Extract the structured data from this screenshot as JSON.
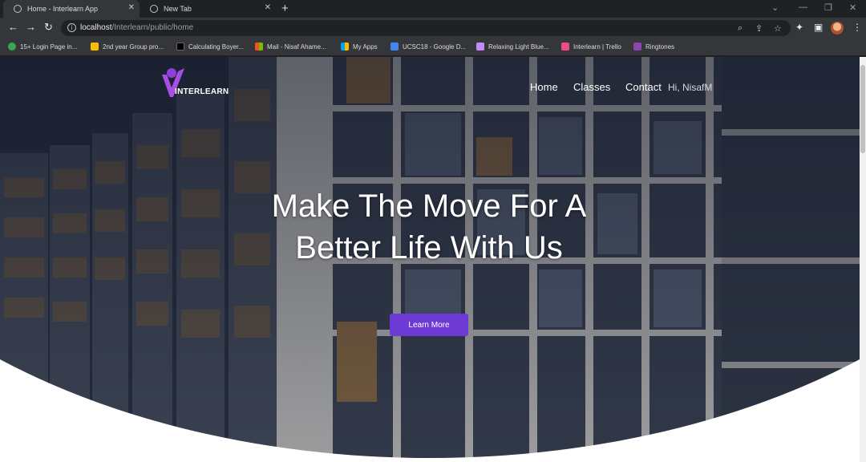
{
  "tabs": [
    {
      "title": "Home - Interlearn App",
      "active": true
    },
    {
      "title": "New Tab",
      "active": false
    }
  ],
  "address_bar": {
    "host": "localhost",
    "path": "/Interlearn/public/home"
  },
  "bookmarks": [
    {
      "label": "15+ Login Page in...",
      "color": "#34a853"
    },
    {
      "label": "2nd year Group pro...",
      "color": "#fbbc04"
    },
    {
      "label": "Calculating Boyer...",
      "color": "#000000"
    },
    {
      "label": "Mail - Nisaf Ahame...",
      "color": "#f25022"
    },
    {
      "label": "My Apps",
      "color": "#7fba00"
    },
    {
      "label": "UCSC18 - Google D...",
      "color": "#4285f4"
    },
    {
      "label": "Relaxing Light Blue...",
      "color": "#c58af9"
    },
    {
      "label": "Interlearn | Trello",
      "color": "#ea4c89"
    },
    {
      "label": "Ringtones",
      "color": "#8e44ad"
    }
  ],
  "site": {
    "logo_text": "INTERLEARN",
    "nav": [
      "Home",
      "Classes",
      "Contact"
    ],
    "greeting": "Hi, NisafM",
    "headline_line1": "Make The Move For A",
    "headline_line2": "Better Life With Us",
    "cta_label": "Learn More"
  },
  "colors": {
    "brand_purple": "#6d3ad6",
    "chrome_dark": "#202124",
    "chrome_mid": "#35363a"
  }
}
